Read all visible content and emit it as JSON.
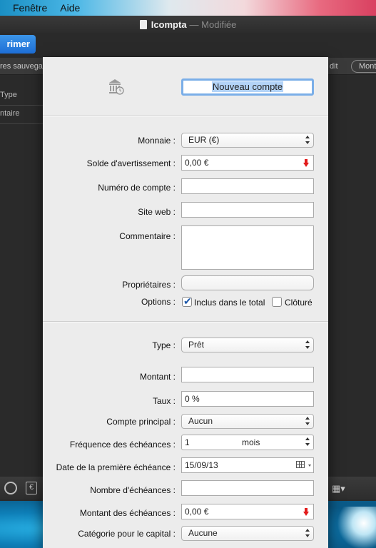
{
  "menubar": {
    "items": [
      "Fenêtre",
      "Aide"
    ]
  },
  "window": {
    "title": "Icompta",
    "status": "— Modifiée"
  },
  "toolbar": {
    "print_label": "rimer"
  },
  "tabbar": {
    "left_text": "res sauvega",
    "right_text_1": "dit",
    "right_text_2": "Mont"
  },
  "list": {
    "col_type": "Type",
    "col_comment": "ntaire"
  },
  "sheet": {
    "account_name": "Nouveau compte",
    "currency_label": "Monnaie :",
    "currency_value": "EUR (€)",
    "warning_label": "Solde d'avertissement :",
    "warning_value": "0,00 €",
    "account_number_label": "Numéro de compte :",
    "account_number_value": "",
    "website_label": "Site web :",
    "website_value": "",
    "comment_label": "Commentaire :",
    "owners_label": "Propriétaires :",
    "options_label": "Options :",
    "option_total_label": "Inclus dans le total",
    "option_total_checked": true,
    "option_closed_label": "Clôturé",
    "option_closed_checked": false,
    "type_label": "Type :",
    "type_value": "Prêt",
    "amount_label": "Montant :",
    "amount_value": "",
    "rate_label": "Taux :",
    "rate_value": "0 %",
    "main_account_label": "Compte principal :",
    "main_account_value": "Aucun",
    "frequency_label": "Fréquence des échéances :",
    "frequency_value": "1",
    "frequency_unit": "mois",
    "first_date_label": "Date de la première échéance :",
    "first_date_value": "15/09/13",
    "count_label": "Nombre d'échéances :",
    "count_value": "",
    "installment_label": "Montant des échéances :",
    "installment_value": "0,00 €",
    "capital_category_label": "Catégorie pour le capital :",
    "capital_category_value": "Aucune"
  },
  "colors": {
    "accent": "#1d6ed6",
    "focus_ring": "#7aaee8",
    "warning_arrow": "#e21b1b"
  }
}
